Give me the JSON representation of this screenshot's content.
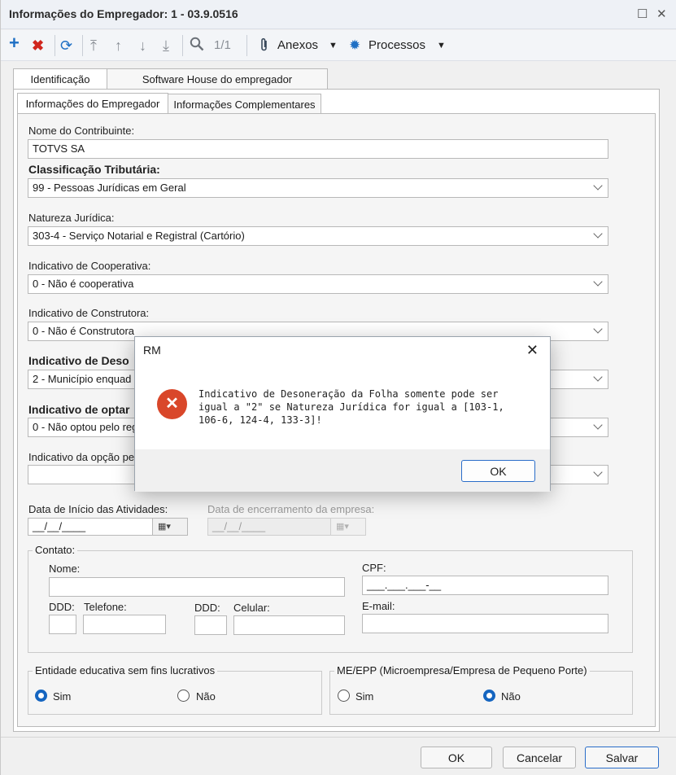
{
  "window": {
    "title": "Informações do Empregador: 1 - 03.9.0516"
  },
  "toolbar": {
    "record_counter": "1/1",
    "anexos_label": "Anexos",
    "processos_label": "Processos"
  },
  "tabs": {
    "top": [
      {
        "label": "Identificação"
      },
      {
        "label": "Software House do empregador"
      }
    ],
    "sub": [
      {
        "label": "Informações do Empregador"
      },
      {
        "label": "Informações Complementares"
      }
    ]
  },
  "form": {
    "nome_contribuinte": {
      "label": "Nome do Contribuinte:",
      "value": "TOTVS SA"
    },
    "classificacao_tributaria": {
      "label": "Classificação Tributária:",
      "value": "99 - Pessoas Jurídicas em Geral"
    },
    "natureza_juridica": {
      "label": "Natureza Jurídica:",
      "value": "303-4 - Serviço Notarial e Registral (Cartório)"
    },
    "ind_cooperativa": {
      "label": "Indicativo de Cooperativa:",
      "value": "0 - Não é cooperativa"
    },
    "ind_construtora": {
      "label": "Indicativo de Construtora:",
      "value": "0 - Não é Construtora"
    },
    "ind_desoneracao": {
      "label": "Indicativo de Deso",
      "value": "2 - Município enquad"
    },
    "ind_opcao": {
      "label": "Indicativo de optar",
      "value": "0 - Não optou pelo reg"
    },
    "ind_opcao_pe": {
      "label": "Indicativo da opção pe",
      "value": ""
    },
    "data_inicio": {
      "label": "Data de Início das Atividades:",
      "value": "__/__/____"
    },
    "data_encerramento": {
      "label": "Data de encerramento da empresa:",
      "value": "__/__/____"
    }
  },
  "contato": {
    "title": "Contato:",
    "nome_label": "Nome:",
    "nome_value": "",
    "cpf_label": "CPF:",
    "cpf_value": "___.___.___-__",
    "ddd_label": "DDD:",
    "telefone_label": "Telefone:",
    "ddd2_label": "DDD:",
    "celular_label": "Celular:",
    "email_label": "E-mail:"
  },
  "entidade": {
    "title": "Entidade educativa sem fins lucrativos",
    "sim": "Sim",
    "nao": "Não",
    "selected": "Sim"
  },
  "meepp": {
    "title": "ME/EPP (Microempresa/Empresa de Pequeno Porte)",
    "sim": "Sim",
    "nao": "Não",
    "selected": "Não"
  },
  "buttons": {
    "ok": "OK",
    "cancelar": "Cancelar",
    "salvar": "Salvar"
  },
  "dialog": {
    "title": "RM",
    "message": "Indicativo de Desoneração da Folha somente pode ser igual a \"2\" se Natureza Jurídica  for igual a [103-1, 106-6, 124-4, 133-3]!",
    "ok_label": "OK"
  },
  "colors": {
    "accent": "#1565c0",
    "error": "#d9472a",
    "add": "#1e6fc4",
    "delete": "#d0261d"
  },
  "icons": [
    "plus-icon",
    "delete-icon",
    "refresh-icon",
    "first-icon",
    "prev-icon",
    "next-icon",
    "last-icon",
    "search-icon",
    "paperclip-icon",
    "gear-icon",
    "calendar-icon",
    "error-icon"
  ]
}
